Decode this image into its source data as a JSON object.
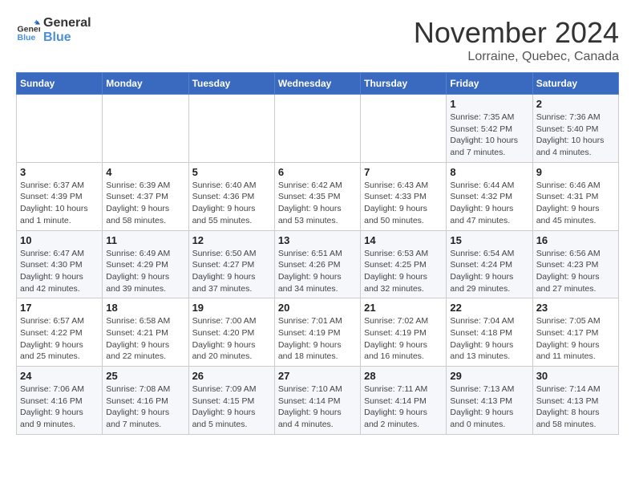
{
  "header": {
    "logo_line1": "General",
    "logo_line2": "Blue",
    "month": "November 2024",
    "location": "Lorraine, Quebec, Canada"
  },
  "weekdays": [
    "Sunday",
    "Monday",
    "Tuesday",
    "Wednesday",
    "Thursday",
    "Friday",
    "Saturday"
  ],
  "weeks": [
    [
      {
        "day": "",
        "info": ""
      },
      {
        "day": "",
        "info": ""
      },
      {
        "day": "",
        "info": ""
      },
      {
        "day": "",
        "info": ""
      },
      {
        "day": "",
        "info": ""
      },
      {
        "day": "1",
        "info": "Sunrise: 7:35 AM\nSunset: 5:42 PM\nDaylight: 10 hours and 7 minutes."
      },
      {
        "day": "2",
        "info": "Sunrise: 7:36 AM\nSunset: 5:40 PM\nDaylight: 10 hours and 4 minutes."
      }
    ],
    [
      {
        "day": "3",
        "info": "Sunrise: 6:37 AM\nSunset: 4:39 PM\nDaylight: 10 hours and 1 minute."
      },
      {
        "day": "4",
        "info": "Sunrise: 6:39 AM\nSunset: 4:37 PM\nDaylight: 9 hours and 58 minutes."
      },
      {
        "day": "5",
        "info": "Sunrise: 6:40 AM\nSunset: 4:36 PM\nDaylight: 9 hours and 55 minutes."
      },
      {
        "day": "6",
        "info": "Sunrise: 6:42 AM\nSunset: 4:35 PM\nDaylight: 9 hours and 53 minutes."
      },
      {
        "day": "7",
        "info": "Sunrise: 6:43 AM\nSunset: 4:33 PM\nDaylight: 9 hours and 50 minutes."
      },
      {
        "day": "8",
        "info": "Sunrise: 6:44 AM\nSunset: 4:32 PM\nDaylight: 9 hours and 47 minutes."
      },
      {
        "day": "9",
        "info": "Sunrise: 6:46 AM\nSunset: 4:31 PM\nDaylight: 9 hours and 45 minutes."
      }
    ],
    [
      {
        "day": "10",
        "info": "Sunrise: 6:47 AM\nSunset: 4:30 PM\nDaylight: 9 hours and 42 minutes."
      },
      {
        "day": "11",
        "info": "Sunrise: 6:49 AM\nSunset: 4:29 PM\nDaylight: 9 hours and 39 minutes."
      },
      {
        "day": "12",
        "info": "Sunrise: 6:50 AM\nSunset: 4:27 PM\nDaylight: 9 hours and 37 minutes."
      },
      {
        "day": "13",
        "info": "Sunrise: 6:51 AM\nSunset: 4:26 PM\nDaylight: 9 hours and 34 minutes."
      },
      {
        "day": "14",
        "info": "Sunrise: 6:53 AM\nSunset: 4:25 PM\nDaylight: 9 hours and 32 minutes."
      },
      {
        "day": "15",
        "info": "Sunrise: 6:54 AM\nSunset: 4:24 PM\nDaylight: 9 hours and 29 minutes."
      },
      {
        "day": "16",
        "info": "Sunrise: 6:56 AM\nSunset: 4:23 PM\nDaylight: 9 hours and 27 minutes."
      }
    ],
    [
      {
        "day": "17",
        "info": "Sunrise: 6:57 AM\nSunset: 4:22 PM\nDaylight: 9 hours and 25 minutes."
      },
      {
        "day": "18",
        "info": "Sunrise: 6:58 AM\nSunset: 4:21 PM\nDaylight: 9 hours and 22 minutes."
      },
      {
        "day": "19",
        "info": "Sunrise: 7:00 AM\nSunset: 4:20 PM\nDaylight: 9 hours and 20 minutes."
      },
      {
        "day": "20",
        "info": "Sunrise: 7:01 AM\nSunset: 4:19 PM\nDaylight: 9 hours and 18 minutes."
      },
      {
        "day": "21",
        "info": "Sunrise: 7:02 AM\nSunset: 4:19 PM\nDaylight: 9 hours and 16 minutes."
      },
      {
        "day": "22",
        "info": "Sunrise: 7:04 AM\nSunset: 4:18 PM\nDaylight: 9 hours and 13 minutes."
      },
      {
        "day": "23",
        "info": "Sunrise: 7:05 AM\nSunset: 4:17 PM\nDaylight: 9 hours and 11 minutes."
      }
    ],
    [
      {
        "day": "24",
        "info": "Sunrise: 7:06 AM\nSunset: 4:16 PM\nDaylight: 9 hours and 9 minutes."
      },
      {
        "day": "25",
        "info": "Sunrise: 7:08 AM\nSunset: 4:16 PM\nDaylight: 9 hours and 7 minutes."
      },
      {
        "day": "26",
        "info": "Sunrise: 7:09 AM\nSunset: 4:15 PM\nDaylight: 9 hours and 5 minutes."
      },
      {
        "day": "27",
        "info": "Sunrise: 7:10 AM\nSunset: 4:14 PM\nDaylight: 9 hours and 4 minutes."
      },
      {
        "day": "28",
        "info": "Sunrise: 7:11 AM\nSunset: 4:14 PM\nDaylight: 9 hours and 2 minutes."
      },
      {
        "day": "29",
        "info": "Sunrise: 7:13 AM\nSunset: 4:13 PM\nDaylight: 9 hours and 0 minutes."
      },
      {
        "day": "30",
        "info": "Sunrise: 7:14 AM\nSunset: 4:13 PM\nDaylight: 8 hours and 58 minutes."
      }
    ]
  ]
}
